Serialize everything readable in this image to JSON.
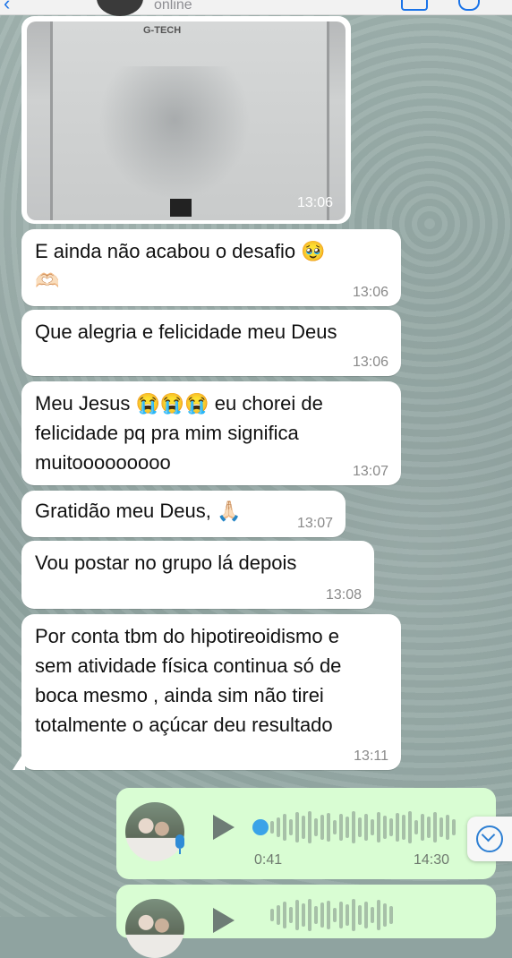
{
  "header": {
    "status": "online"
  },
  "photo_message": {
    "brand": "G-TECH",
    "time": "13:06"
  },
  "messages": [
    {
      "text_lines": [
        "E ainda não acabou o desafio 🥹",
        "🫶🏻"
      ],
      "time": "13:06"
    },
    {
      "text_lines": [
        "Que alegria e felicidade meu Deus"
      ],
      "time": "13:06"
    },
    {
      "text_lines": [
        "Meu Jesus 😭😭😭 eu chorei de",
        "felicidade pq pra mim significa",
        "muitooooooooo"
      ],
      "time": "13:07"
    },
    {
      "text_lines": [
        "Gratidão meu Deus, 🙏🏻"
      ],
      "time": "13:07"
    },
    {
      "text_lines": [
        "Vou postar no grupo lá depois"
      ],
      "time": "13:08"
    },
    {
      "text_lines": [
        "Por conta tbm do hipotireoidismo e",
        "sem atividade física continua só de",
        "boca mesmo , ainda sim não tirei",
        "totalmente o açúcar deu resultado"
      ],
      "time": "13:11"
    }
  ],
  "audio_messages": [
    {
      "duration": "0:41",
      "time": "14:30"
    }
  ],
  "icons": {
    "back": "chevron-left-icon",
    "play": "play-icon",
    "mic": "microphone-icon",
    "scroll": "chevron-down-circle-icon"
  },
  "colors": {
    "incoming_bubble": "#ffffff",
    "outgoing_bubble": "#d9fdd3",
    "accent": "#2d7fd3"
  }
}
